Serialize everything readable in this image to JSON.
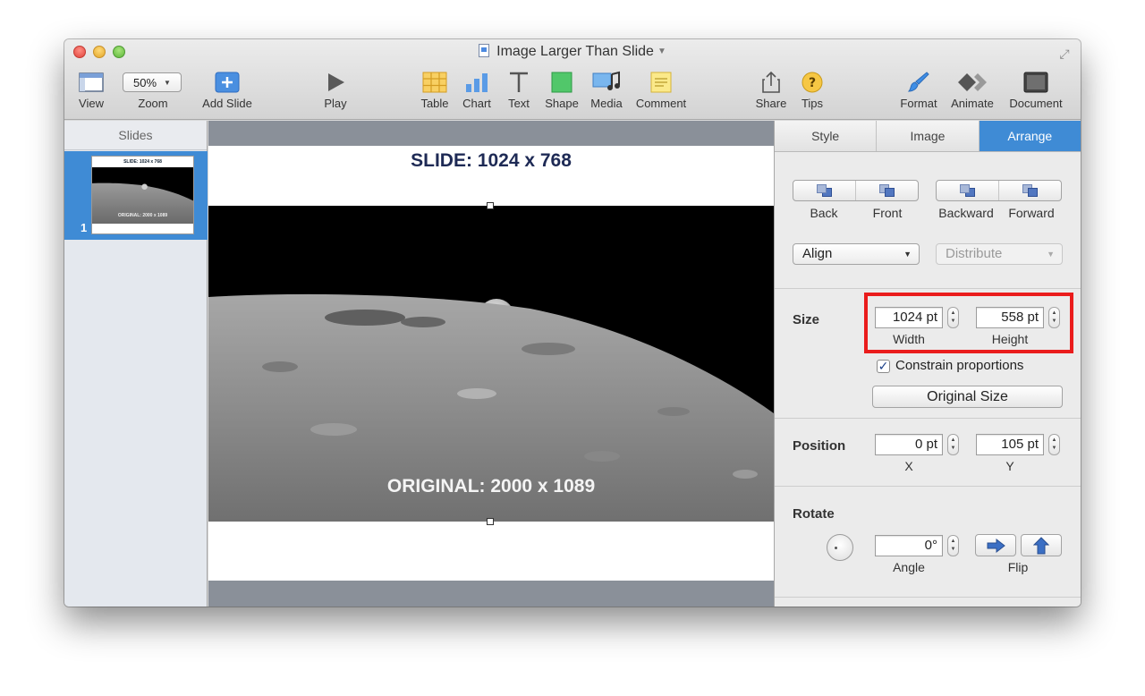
{
  "window": {
    "title": "Image Larger Than Slide"
  },
  "toolbar": {
    "view": "View",
    "zoom": "Zoom",
    "zoom_value": "50%",
    "add_slide": "Add Slide",
    "play": "Play",
    "table": "Table",
    "chart": "Chart",
    "text": "Text",
    "shape": "Shape",
    "media": "Media",
    "comment": "Comment",
    "share": "Share",
    "tips": "Tips",
    "format": "Format",
    "animate": "Animate",
    "document": "Document"
  },
  "slides": {
    "header": "Slides",
    "items": [
      {
        "number": "1"
      }
    ]
  },
  "slide": {
    "title": "SLIDE: 1024 x 768",
    "caption": "ORIGINAL: 2000 x 1089"
  },
  "inspector": {
    "tabs": [
      "Style",
      "Image",
      "Arrange"
    ],
    "active_tab": "Arrange",
    "arrange": {
      "back": "Back",
      "front": "Front",
      "backward": "Backward",
      "forward": "Forward",
      "align": "Align",
      "distribute": "Distribute",
      "size_label": "Size",
      "width_value": "1024 pt",
      "width_label": "Width",
      "height_value": "558 pt",
      "height_label": "Height",
      "constrain": "Constrain proportions",
      "constrain_checked": true,
      "original_size": "Original Size",
      "position_label": "Position",
      "x_value": "0 pt",
      "x_label": "X",
      "y_value": "105 pt",
      "y_label": "Y",
      "rotate_label": "Rotate",
      "angle_value": "0°",
      "angle_label": "Angle",
      "flip_label": "Flip"
    }
  },
  "colors": {
    "accent": "#3f8bd5",
    "highlight": "#ea1c1c",
    "canvas_bg": "#8a9099"
  }
}
